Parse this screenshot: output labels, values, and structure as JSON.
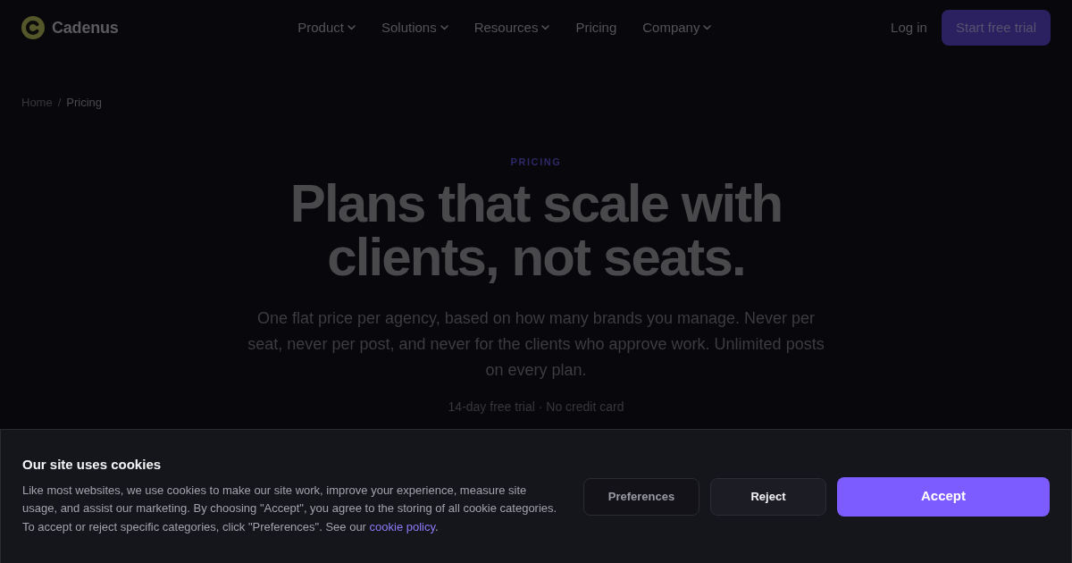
{
  "header": {
    "brand": "Cadenus",
    "nav": [
      {
        "label": "Product",
        "dropdown": true
      },
      {
        "label": "Solutions",
        "dropdown": true
      },
      {
        "label": "Resources",
        "dropdown": true
      },
      {
        "label": "Pricing",
        "dropdown": false
      },
      {
        "label": "Company",
        "dropdown": true
      }
    ],
    "login": "Log in",
    "cta": "Start free trial"
  },
  "breadcrumb": {
    "separator": "/",
    "items": [
      {
        "label": "Home",
        "current": false
      },
      {
        "label": "Pricing",
        "current": true
      }
    ]
  },
  "hero": {
    "eyebrow": "PRICING",
    "title": "Plans that scale with clients, not seats.",
    "lead": "One flat price per agency, based on how many brands you manage. Never per seat, never per post, and never for the clients who approve work. Unlimited posts on every plan.",
    "note": "14-day free trial · No credit card"
  },
  "cookie_banner": {
    "title": "Our site uses cookies",
    "body_before": "Like most websites, we use cookies to make our site work, improve your experience, measure site usage, and assist our marketing. By choosing \"Accept\", you agree to the storing of all cookie categories. To accept or reject specific categories, click \"Preferences\". See our ",
    "link": "cookie policy",
    "body_after": ".",
    "buttons": [
      {
        "label": "Preferences",
        "kind": "outline"
      },
      {
        "label": "Reject",
        "kind": "secondary"
      },
      {
        "label": "Accept",
        "kind": "primary"
      }
    ]
  }
}
